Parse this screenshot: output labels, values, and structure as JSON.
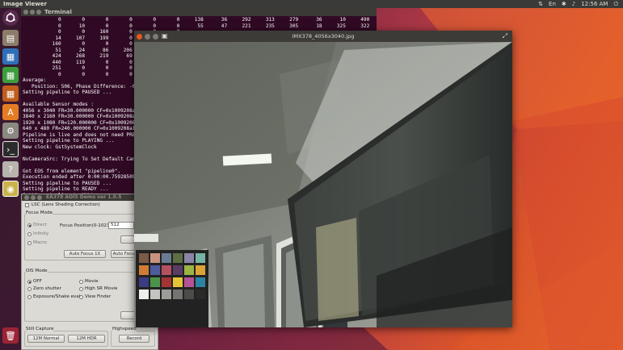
{
  "topbar": {
    "app_title": "Image Viewer",
    "keyboard": "En",
    "time": "12:56 AM"
  },
  "launcher": {
    "items": [
      "ubuntu-dash-icon",
      "files-icon",
      "writer-icon",
      "calc-icon",
      "impress-icon",
      "software-center-icon",
      "settings-icon",
      "terminal-icon",
      "help-icon",
      "camera-app-icon"
    ],
    "trash": "trash-icon"
  },
  "terminal": {
    "title": "Terminal",
    "lines": [
      "            0       0       0       0       0       0     138      36     292     313     279      36      10     490     139     117",
      "            0      10       0       0       0       0      55      47     221     235     305      18     325     322     140      99",
      "            0       0     160       0       0       0",
      "           14     107     199       0       0       0",
      "          160       0       0       0       0       0",
      "           51      24      86     206       0       0",
      "          424     268     219      69       0       0",
      "          440     119       0       0       0       0",
      "          251       0       0       0      29",
      "            0       0       0       0       0",
      "Average:",
      "   Position: 506, Phase Difference: -0.",
      "Setting pipeline to PAUSED ...",
      "",
      "Available Sensor modes :",
      "4056 x 3040 FR=30.000000 CF=0x1009208a",
      "3840 x 2160 FR=30.000000 CF=0x1009208a",
      "1920 x 1080 FR=120.000000 CF=0x1009208",
      "640 x 480 FR=240.000000 CF=0x1009208a1",
      "Pipeline is live and does not need PRE",
      "Setting pipeline to PLAYING ...",
      "New clock: GstSystemClock",
      "",
      "NvCameraSrc: Trying To Set Default Can",
      "",
      "Got EOS from element \"pipeline0\".",
      "Execution ended after 0:00:00.75928509",
      "Setting pipeline to PAUSED ...",
      "Setting pipeline to READY ...",
      "Setting pipeline to NULL ...",
      "Freeing pipeline ...",
      "^C"
    ]
  },
  "panel": {
    "title": "EA378 AOIS Demo ver 1.0.5",
    "lsc_label": "LSC (Lens Shading Correction)",
    "focus_mode_title": "Focus Mode",
    "focus_options": [
      "Direct",
      "Infinity",
      "Macro"
    ],
    "focus_position_label": "Focus Position(0-1023):",
    "focus_position_value": "512",
    "auto_focus_1x": "Auto Focus 1X",
    "auto_focus_2": "Auto Focu",
    "ois_mode_title": "OIS Mode",
    "ois_left": [
      "OFF",
      "Zero shutter",
      "Exposure/Shake eval."
    ],
    "ois_right": [
      "Movie",
      "High SR Movie",
      "View Finder"
    ],
    "still_capture_title": "Still Capture",
    "still_buttons": [
      "12M Normal",
      "12M HDR"
    ],
    "highspeed_title": "Highspeed",
    "record_label": "Record"
  },
  "viewer": {
    "title": "IMX378_4056x3040.jpg"
  },
  "colors": {
    "terminal_bg": "#300a24",
    "close_button": "#e95420",
    "launcher_bg": "#37192d"
  }
}
